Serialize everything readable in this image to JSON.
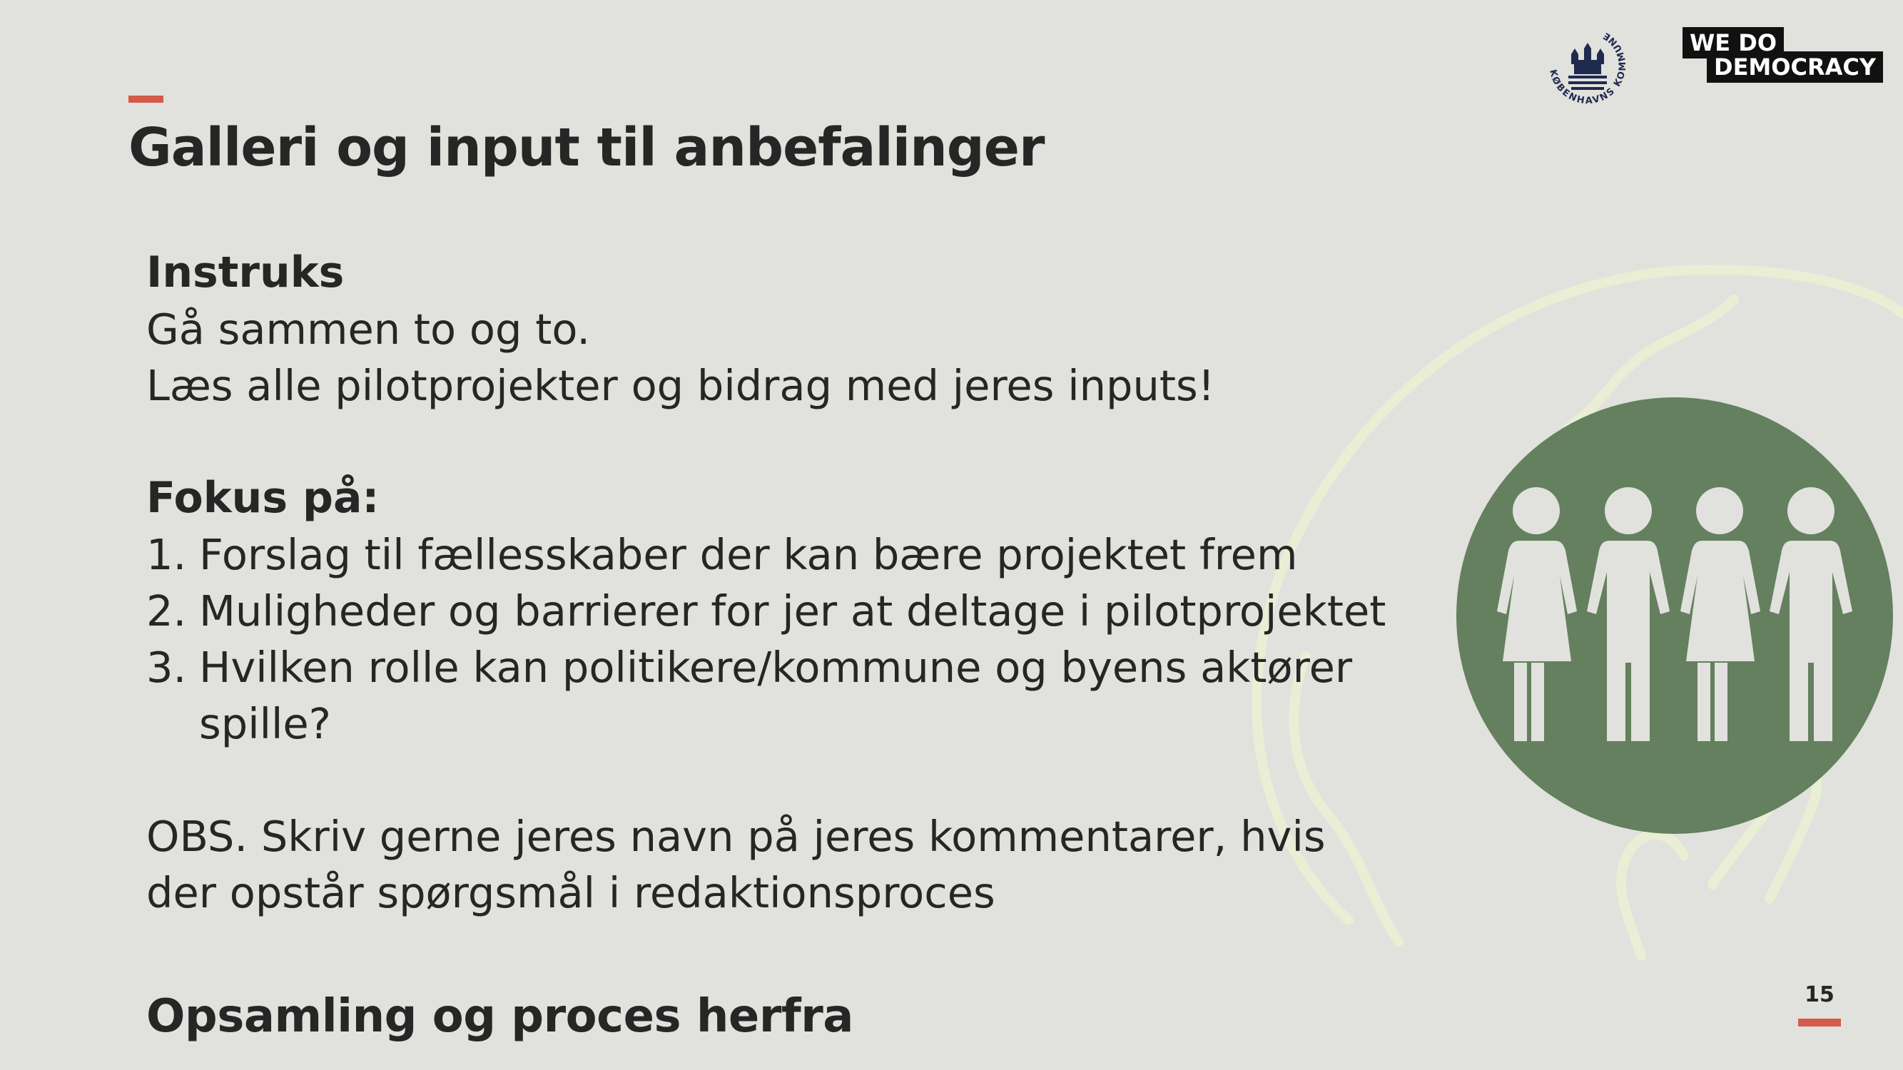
{
  "title": "Galleri og input til anbefalinger",
  "instructions": {
    "heading": "Instruks",
    "lines": [
      "Gå sammen to og to.",
      "Læs alle pilotprojekter og bidrag med jeres inputs!"
    ]
  },
  "focus": {
    "heading": "Fokus på:",
    "items": [
      {
        "num": "1.",
        "text": "Forslag til fællesskaber der kan bære projektet frem"
      },
      {
        "num": "2.",
        "text": "Muligheder og barrierer for jer at deltage i pilotprojektet"
      },
      {
        "num": "3.",
        "text": "Hvilken rolle kan politikere/kommune og byens aktører spille?"
      }
    ]
  },
  "note": {
    "lines": [
      "OBS. Skriv gerne jeres navn på jeres kommentarer, hvis",
      "der opstår spørgsmål i redaktionsproces"
    ]
  },
  "footer_heading": "Opsamling og proces herfra",
  "page_number": "15",
  "logos": {
    "kobenhavn": "KØBENHAVNS KOMMUNE",
    "wedo_top": "WE DO",
    "wedo_bottom": "DEMOCRACY"
  },
  "colors": {
    "background": "#e1e1dd",
    "accent": "#d35b47",
    "circle": "#64805e",
    "figures": "#e1e1dd",
    "globe_stroke": "#e8efd4",
    "text": "#262626",
    "logo_navy": "#1f2a4f"
  },
  "icons": [
    "city-coat-of-arms-icon",
    "globe-outline-icon",
    "people-group-icon"
  ]
}
